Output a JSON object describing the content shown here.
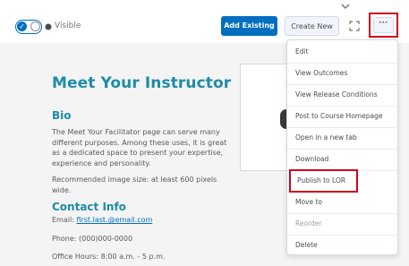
{
  "toolbar": {
    "visibility_label": "Visible",
    "add_existing_label": "Add Existing",
    "create_new_label": "Create New",
    "more_label": "···"
  },
  "content": {
    "title": "Meet Your Instructor",
    "bio_heading": "Bio",
    "bio_paragraph": "The Meet Your Facilitator page can serve many different purposes. Among these uses, it is great as a dedicated space to present your expertise, experience and personality.",
    "image_note": "Recommended image size: at least 600 pixels wide.",
    "contact_heading": "Contact Info",
    "email_label": "Email: ",
    "email_value": "first.last.@email.com",
    "phone": "Phone: (000)000-0000",
    "hours": "Office Hours: 8:00 a.m. - 5 p.m."
  },
  "menu": {
    "items": [
      {
        "label": "Edit"
      },
      {
        "label": "View Outcomes"
      },
      {
        "label": "View Release Conditions"
      },
      {
        "label": "Post to Course Homepage"
      },
      {
        "label": "Open in a new tab"
      },
      {
        "label": "Download"
      },
      {
        "label": "Publish to LOR"
      },
      {
        "label": "Move to"
      },
      {
        "label": "Reorder"
      },
      {
        "label": "Delete"
      }
    ]
  },
  "colors": {
    "primary": "#006fbf",
    "heading": "#1e8ca6",
    "highlight": "#d0021b"
  }
}
